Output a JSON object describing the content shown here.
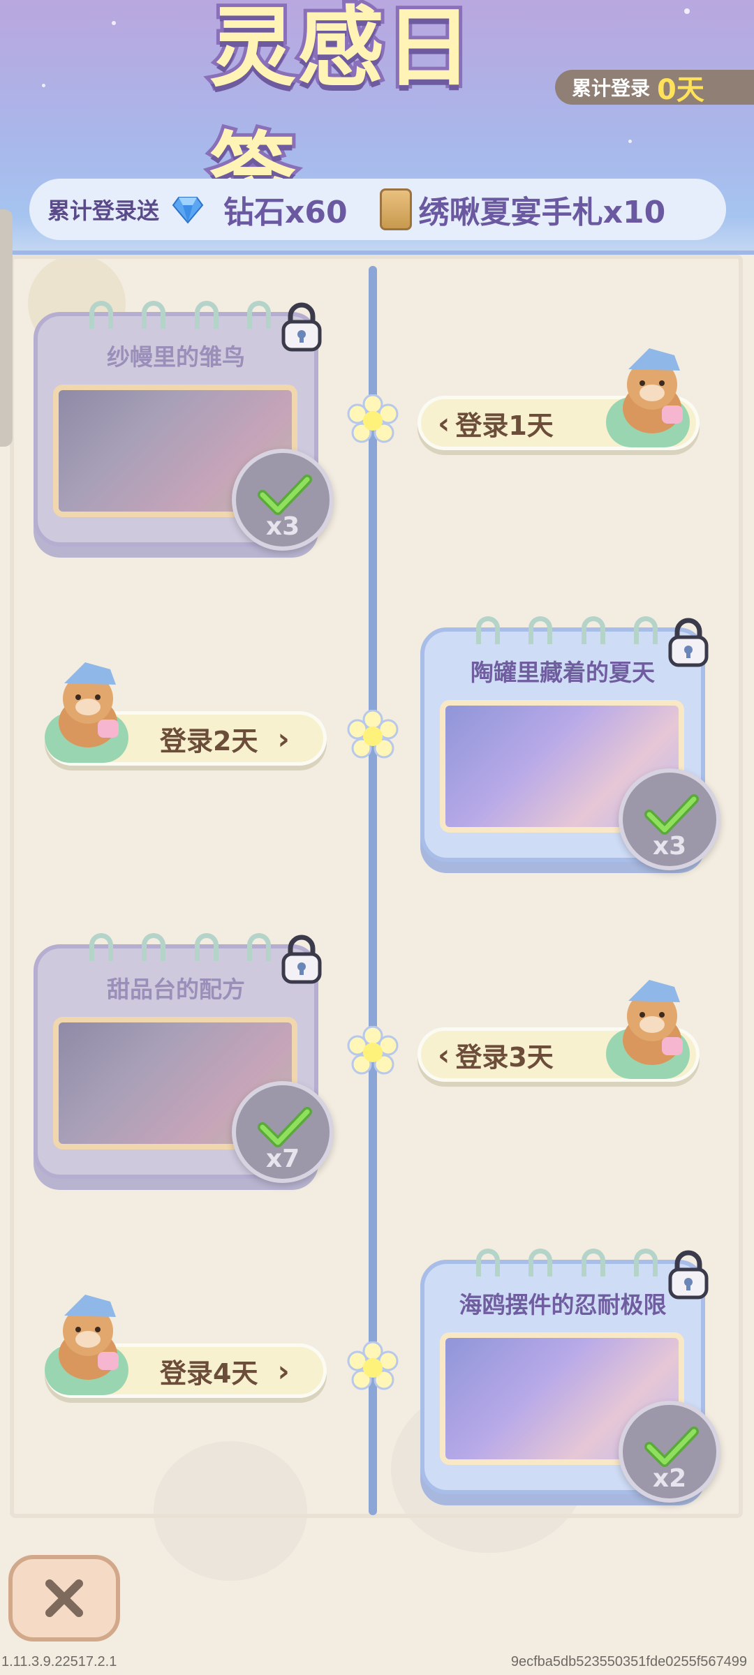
{
  "header": {
    "title": "灵感日签",
    "days_label": "累计登录",
    "days_value": "0天",
    "reward_label": "累计登录送",
    "reward_diamond": "钻石x60",
    "reward_ticket": "绣啾夏宴手札x10"
  },
  "timeline": [
    {
      "card_title": "纱幔里的雏鸟",
      "card_qty": "x3",
      "login_label": "登录1天"
    },
    {
      "card_title": "陶罐里藏着的夏天",
      "card_qty": "x3",
      "login_label": "登录2天"
    },
    {
      "card_title": "甜品台的配方",
      "card_qty": "x7",
      "login_label": "登录3天"
    },
    {
      "card_title": "海鸥摆件的忍耐极限",
      "card_qty": "x2",
      "login_label": "登录4天"
    }
  ],
  "footer": {
    "version": "1.11.3.9.22517.2.1",
    "hash": "9ecfba5db523550351fde0255f567499"
  },
  "colors": {
    "timeline": "#8aa5d6",
    "pill": "#f8f1cf",
    "accent_yellow": "#ffe15a"
  },
  "icons": [
    "diamond-icon",
    "ticket-icon",
    "lock-icon",
    "check-icon",
    "flower-icon",
    "bear-icon",
    "close-icon"
  ]
}
